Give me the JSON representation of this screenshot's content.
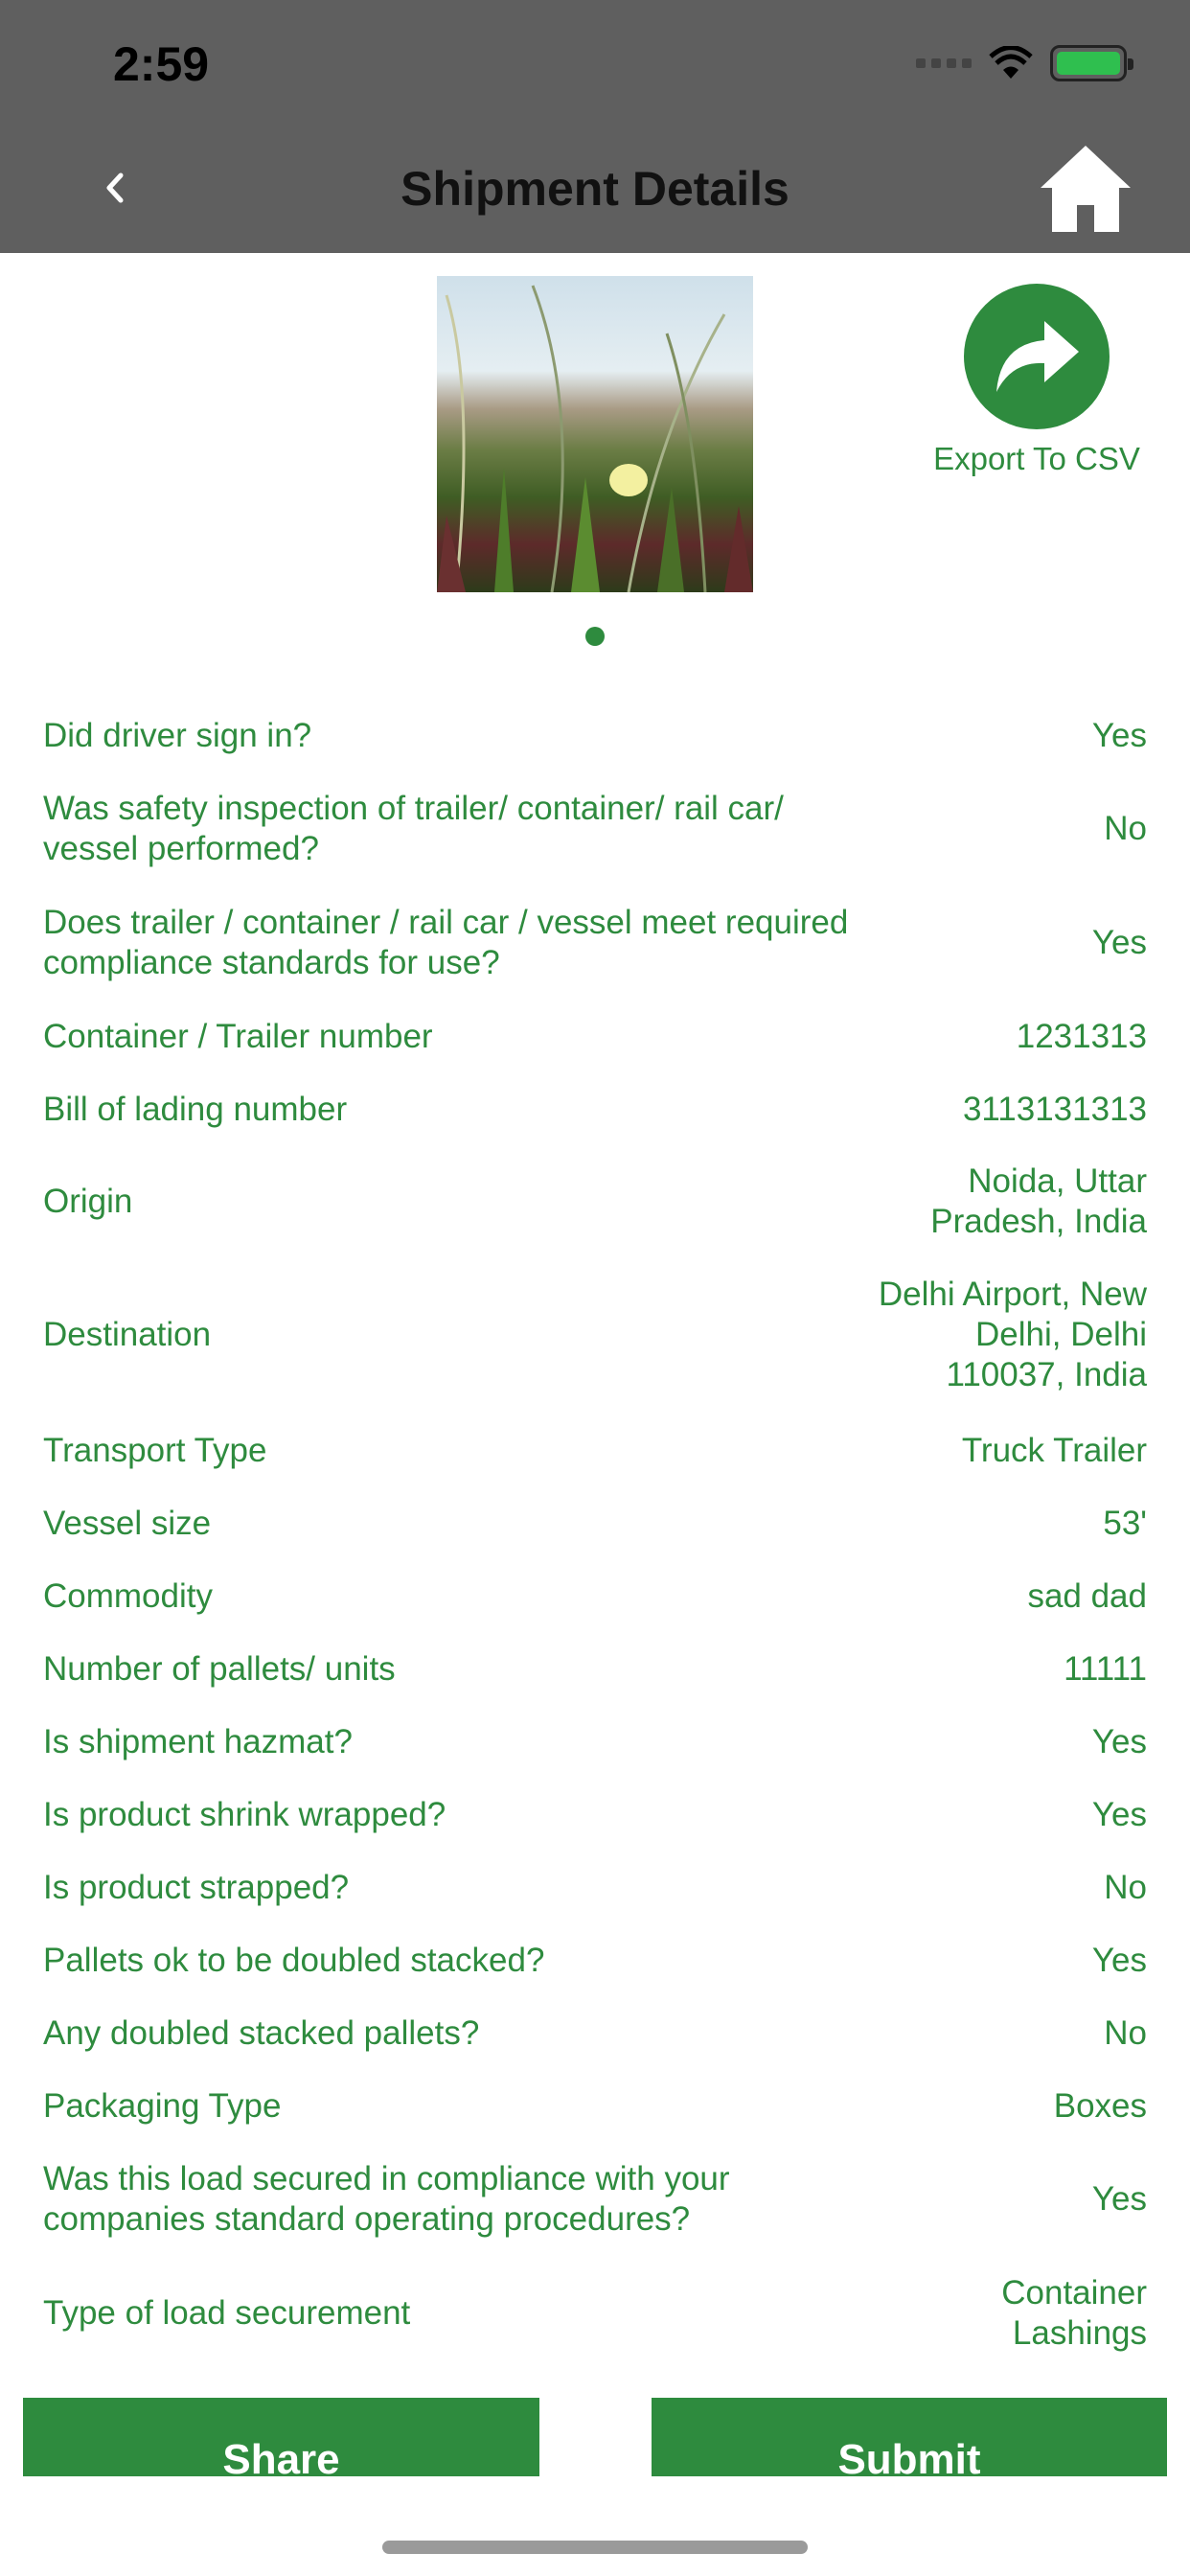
{
  "status_bar": {
    "time": "2:59"
  },
  "header": {
    "title": "Shipment Details"
  },
  "export": {
    "label": "Export To CSV"
  },
  "details": [
    {
      "q": "Did driver sign in?",
      "a": "Yes"
    },
    {
      "q": "Was safety inspection of trailer/ container/ rail car/ vessel performed?",
      "a": "No"
    },
    {
      "q": "Does trailer / container / rail car / vessel meet required compliance standards for use?",
      "a": "Yes"
    },
    {
      "q": "Container / Trailer number",
      "a": "1231313"
    },
    {
      "q": "Bill of lading number",
      "a": "3113131313"
    },
    {
      "q": "Origin",
      "a": "Noida, Uttar Pradesh, India"
    },
    {
      "q": "Destination",
      "a": "Delhi Airport, New Delhi, Delhi 110037, India"
    },
    {
      "q": "Transport Type",
      "a": "Truck Trailer"
    },
    {
      "q": "Vessel size",
      "a": "53'"
    },
    {
      "q": "Commodity",
      "a": "sad dad"
    },
    {
      "q": "Number of pallets/ units",
      "a": "11111"
    },
    {
      "q": "Is shipment hazmat?",
      "a": "Yes"
    },
    {
      "q": "Is product shrink wrapped?",
      "a": "Yes"
    },
    {
      "q": "Is product strapped?",
      "a": "No"
    },
    {
      "q": "Pallets ok to be doubled stacked?",
      "a": "Yes"
    },
    {
      "q": "Any doubled stacked pallets?",
      "a": "No"
    },
    {
      "q": "Packaging Type",
      "a": "Boxes"
    },
    {
      "q": "Was this load secured in compliance with your companies standard operating procedures?",
      "a": "Yes"
    },
    {
      "q": "Type of load securement",
      "a": "Container Lashings"
    }
  ],
  "buttons": {
    "share": "Share",
    "submit": "Submit"
  }
}
